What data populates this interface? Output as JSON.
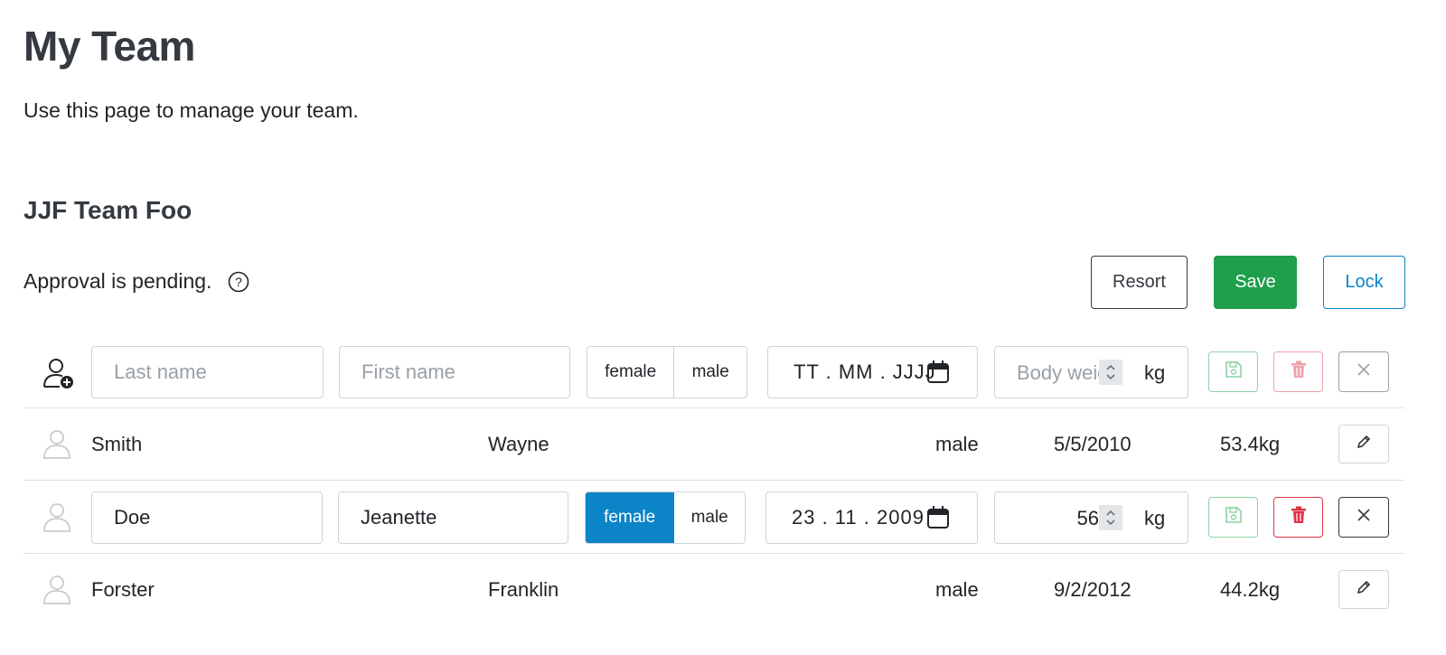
{
  "page": {
    "title": "My Team",
    "subtitle": "Use this page to manage your team."
  },
  "team": {
    "name": "JJF Team Foo",
    "status": "Approval is pending.",
    "help_icon": "question-circle-icon"
  },
  "actions": {
    "resort": "Resort",
    "save": "Save",
    "lock": "Lock"
  },
  "colors": {
    "primary": "#0b84c8",
    "success": "#1e9f4a",
    "danger": "#dc3545",
    "dark": "#343a40"
  },
  "new_row": {
    "icon": "add-person-icon",
    "last_name_placeholder": "Last name",
    "first_name_placeholder": "First name",
    "gender_options": [
      "female",
      "male"
    ],
    "date_placeholder": "TT . MM . JJJJ",
    "weight_placeholder": "Body weight",
    "unit": "kg"
  },
  "members": [
    {
      "icon": "person-icon",
      "last_name": "Smith",
      "first_name": "Wayne",
      "gender": "male",
      "birthdate": "5/5/2010",
      "weight": "53.4kg"
    },
    {
      "icon": "person-icon",
      "last_name": "Doe",
      "first_name": "Jeanette",
      "gender_options": [
        "female",
        "male"
      ],
      "gender_selected": "female",
      "birthdate": "23 . 11 . 2009",
      "weight": "56",
      "unit": "kg",
      "editing": true
    },
    {
      "icon": "person-icon",
      "last_name": "Forster",
      "first_name": "Franklin",
      "gender": "male",
      "birthdate": "9/2/2012",
      "weight": "44.2kg"
    }
  ]
}
